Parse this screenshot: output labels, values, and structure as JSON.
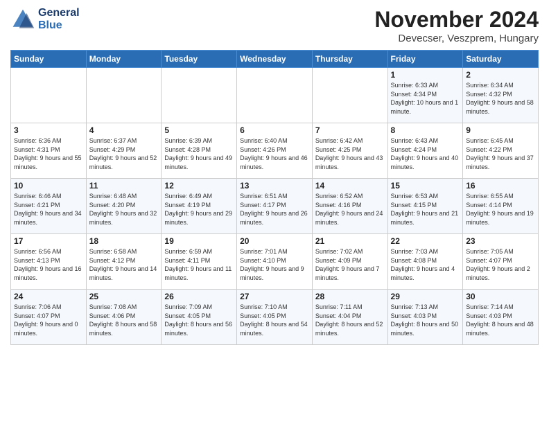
{
  "logo": {
    "line1": "General",
    "line2": "Blue"
  },
  "title": "November 2024",
  "subtitle": "Devecser, Veszprem, Hungary",
  "days_of_week": [
    "Sunday",
    "Monday",
    "Tuesday",
    "Wednesday",
    "Thursday",
    "Friday",
    "Saturday"
  ],
  "weeks": [
    [
      {
        "day": "",
        "info": ""
      },
      {
        "day": "",
        "info": ""
      },
      {
        "day": "",
        "info": ""
      },
      {
        "day": "",
        "info": ""
      },
      {
        "day": "",
        "info": ""
      },
      {
        "day": "1",
        "info": "Sunrise: 6:33 AM\nSunset: 4:34 PM\nDaylight: 10 hours and 1 minute."
      },
      {
        "day": "2",
        "info": "Sunrise: 6:34 AM\nSunset: 4:32 PM\nDaylight: 9 hours and 58 minutes."
      }
    ],
    [
      {
        "day": "3",
        "info": "Sunrise: 6:36 AM\nSunset: 4:31 PM\nDaylight: 9 hours and 55 minutes."
      },
      {
        "day": "4",
        "info": "Sunrise: 6:37 AM\nSunset: 4:29 PM\nDaylight: 9 hours and 52 minutes."
      },
      {
        "day": "5",
        "info": "Sunrise: 6:39 AM\nSunset: 4:28 PM\nDaylight: 9 hours and 49 minutes."
      },
      {
        "day": "6",
        "info": "Sunrise: 6:40 AM\nSunset: 4:26 PM\nDaylight: 9 hours and 46 minutes."
      },
      {
        "day": "7",
        "info": "Sunrise: 6:42 AM\nSunset: 4:25 PM\nDaylight: 9 hours and 43 minutes."
      },
      {
        "day": "8",
        "info": "Sunrise: 6:43 AM\nSunset: 4:24 PM\nDaylight: 9 hours and 40 minutes."
      },
      {
        "day": "9",
        "info": "Sunrise: 6:45 AM\nSunset: 4:22 PM\nDaylight: 9 hours and 37 minutes."
      }
    ],
    [
      {
        "day": "10",
        "info": "Sunrise: 6:46 AM\nSunset: 4:21 PM\nDaylight: 9 hours and 34 minutes."
      },
      {
        "day": "11",
        "info": "Sunrise: 6:48 AM\nSunset: 4:20 PM\nDaylight: 9 hours and 32 minutes."
      },
      {
        "day": "12",
        "info": "Sunrise: 6:49 AM\nSunset: 4:19 PM\nDaylight: 9 hours and 29 minutes."
      },
      {
        "day": "13",
        "info": "Sunrise: 6:51 AM\nSunset: 4:17 PM\nDaylight: 9 hours and 26 minutes."
      },
      {
        "day": "14",
        "info": "Sunrise: 6:52 AM\nSunset: 4:16 PM\nDaylight: 9 hours and 24 minutes."
      },
      {
        "day": "15",
        "info": "Sunrise: 6:53 AM\nSunset: 4:15 PM\nDaylight: 9 hours and 21 minutes."
      },
      {
        "day": "16",
        "info": "Sunrise: 6:55 AM\nSunset: 4:14 PM\nDaylight: 9 hours and 19 minutes."
      }
    ],
    [
      {
        "day": "17",
        "info": "Sunrise: 6:56 AM\nSunset: 4:13 PM\nDaylight: 9 hours and 16 minutes."
      },
      {
        "day": "18",
        "info": "Sunrise: 6:58 AM\nSunset: 4:12 PM\nDaylight: 9 hours and 14 minutes."
      },
      {
        "day": "19",
        "info": "Sunrise: 6:59 AM\nSunset: 4:11 PM\nDaylight: 9 hours and 11 minutes."
      },
      {
        "day": "20",
        "info": "Sunrise: 7:01 AM\nSunset: 4:10 PM\nDaylight: 9 hours and 9 minutes."
      },
      {
        "day": "21",
        "info": "Sunrise: 7:02 AM\nSunset: 4:09 PM\nDaylight: 9 hours and 7 minutes."
      },
      {
        "day": "22",
        "info": "Sunrise: 7:03 AM\nSunset: 4:08 PM\nDaylight: 9 hours and 4 minutes."
      },
      {
        "day": "23",
        "info": "Sunrise: 7:05 AM\nSunset: 4:07 PM\nDaylight: 9 hours and 2 minutes."
      }
    ],
    [
      {
        "day": "24",
        "info": "Sunrise: 7:06 AM\nSunset: 4:07 PM\nDaylight: 9 hours and 0 minutes."
      },
      {
        "day": "25",
        "info": "Sunrise: 7:08 AM\nSunset: 4:06 PM\nDaylight: 8 hours and 58 minutes."
      },
      {
        "day": "26",
        "info": "Sunrise: 7:09 AM\nSunset: 4:05 PM\nDaylight: 8 hours and 56 minutes."
      },
      {
        "day": "27",
        "info": "Sunrise: 7:10 AM\nSunset: 4:05 PM\nDaylight: 8 hours and 54 minutes."
      },
      {
        "day": "28",
        "info": "Sunrise: 7:11 AM\nSunset: 4:04 PM\nDaylight: 8 hours and 52 minutes."
      },
      {
        "day": "29",
        "info": "Sunrise: 7:13 AM\nSunset: 4:03 PM\nDaylight: 8 hours and 50 minutes."
      },
      {
        "day": "30",
        "info": "Sunrise: 7:14 AM\nSunset: 4:03 PM\nDaylight: 8 hours and 48 minutes."
      }
    ]
  ]
}
